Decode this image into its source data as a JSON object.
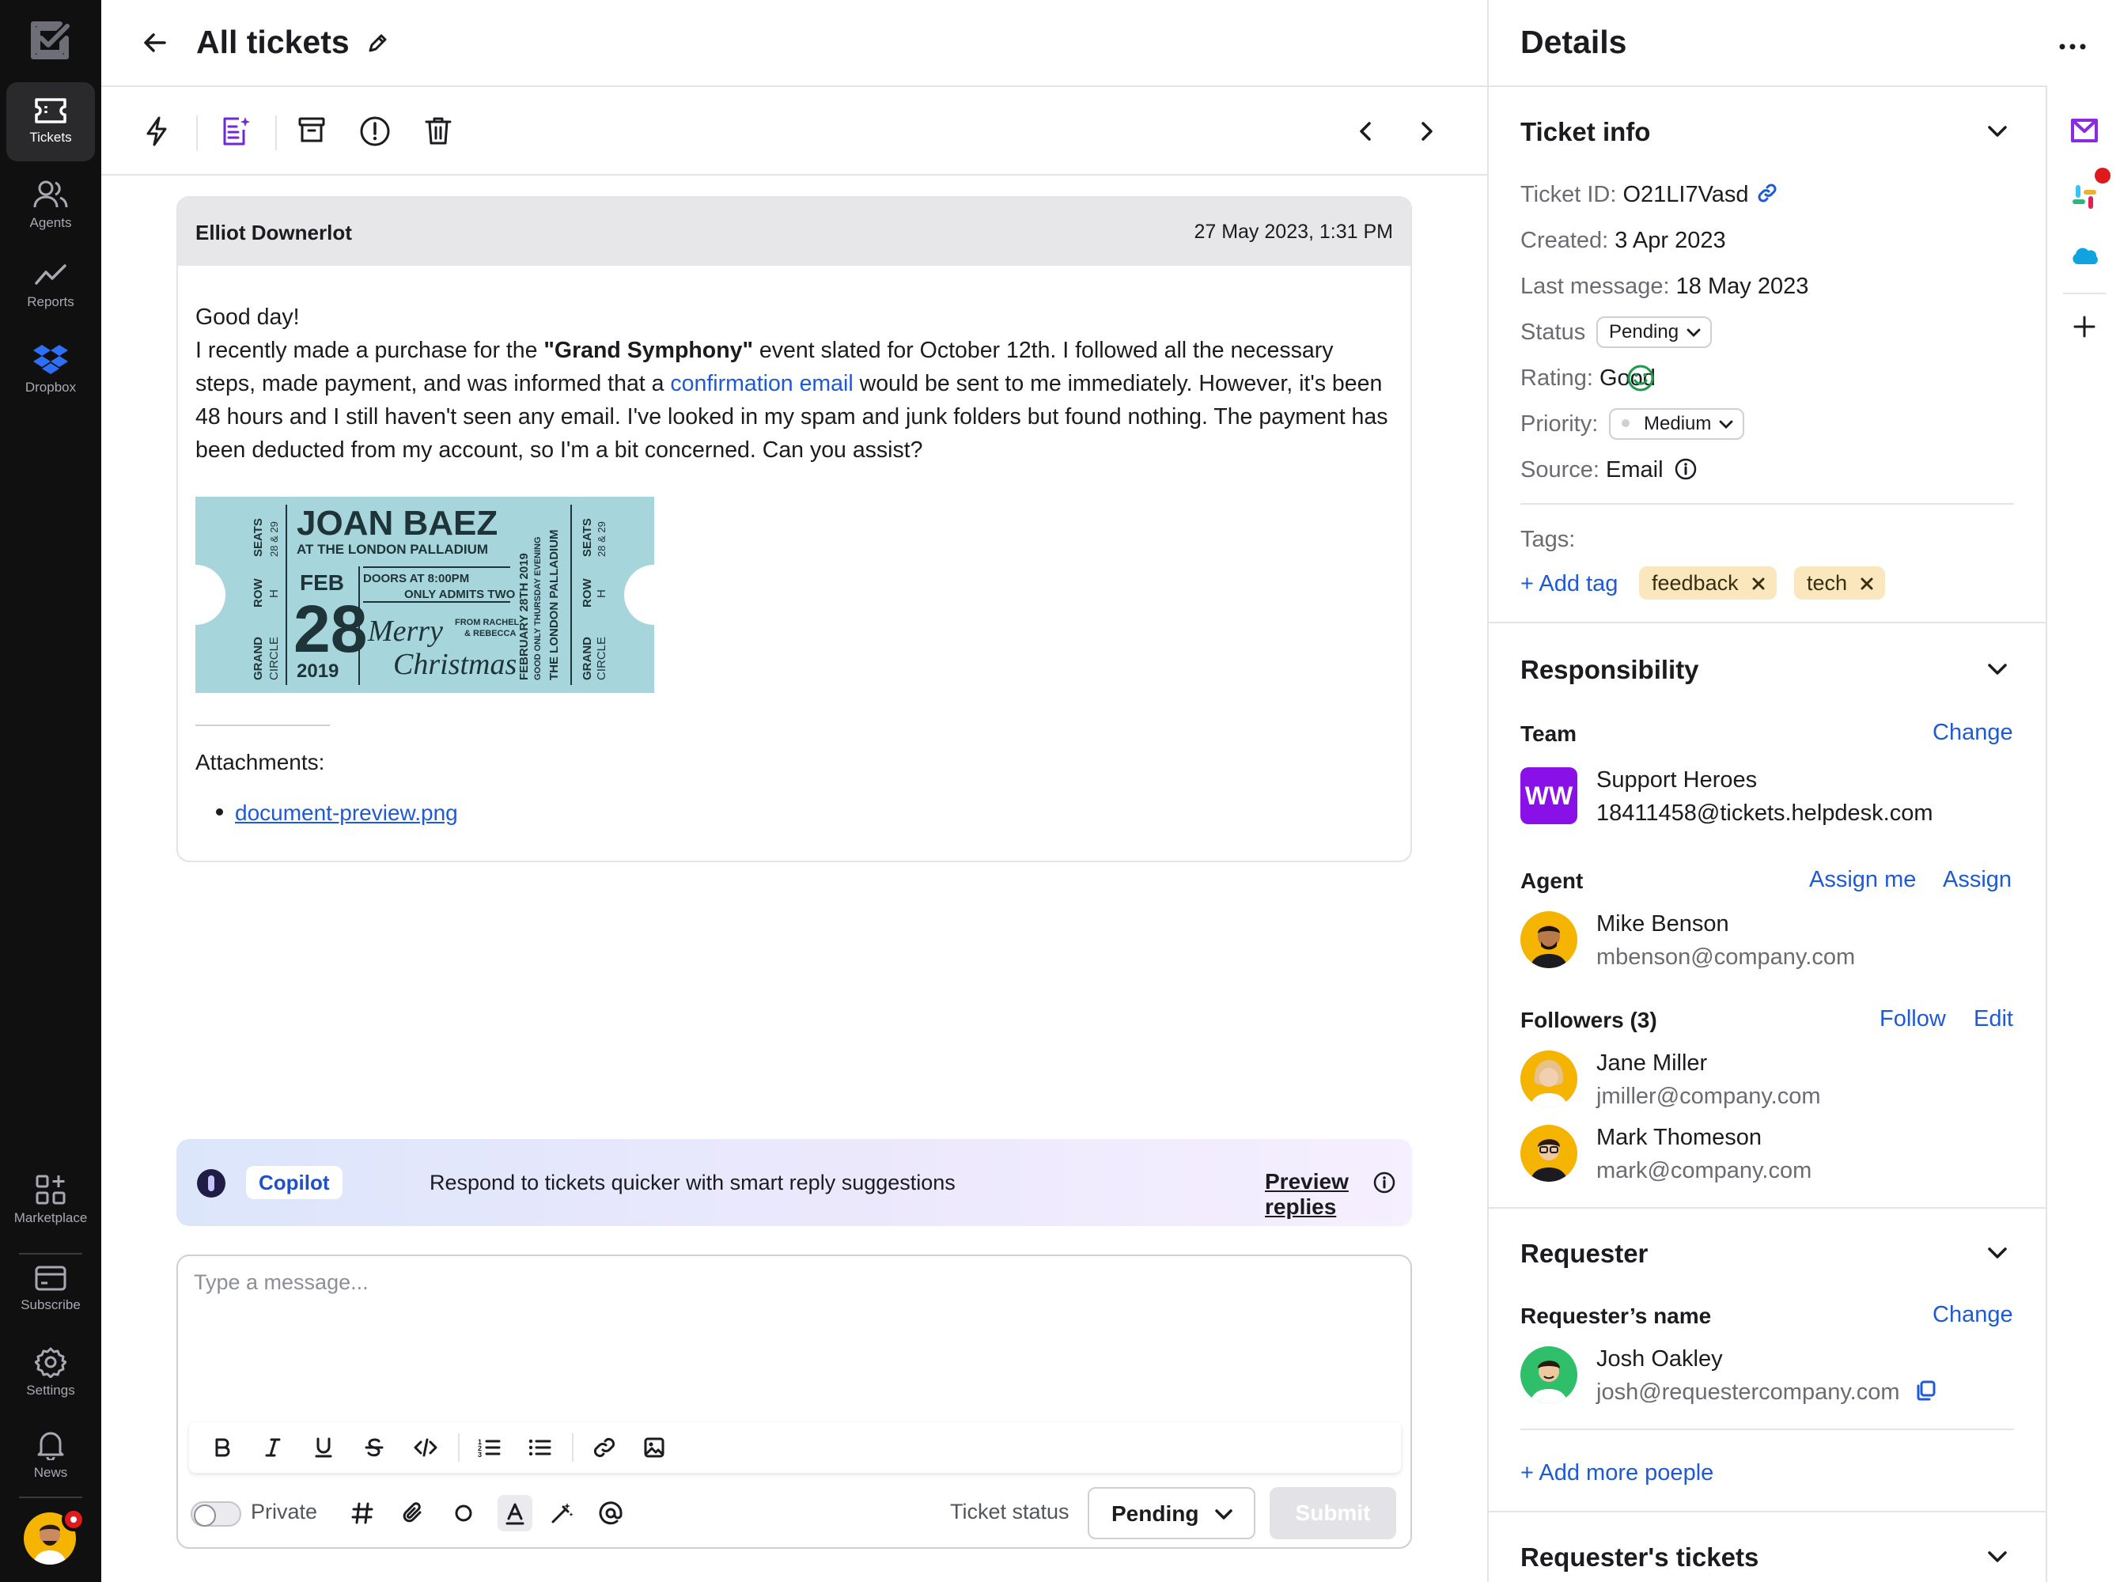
{
  "nav": {
    "items": [
      {
        "label": "Tickets",
        "icon": "ticket-icon",
        "active": true
      },
      {
        "label": "Agents",
        "icon": "agents-icon"
      },
      {
        "label": "Reports",
        "icon": "reports-icon"
      },
      {
        "label": "Dropbox",
        "icon": "dropbox-icon"
      }
    ],
    "bottom": [
      {
        "label": "Marketplace",
        "icon": "marketplace-icon"
      },
      {
        "label": "Subscribe",
        "icon": "card-icon"
      },
      {
        "label": "Settings",
        "icon": "gear-icon"
      },
      {
        "label": "News",
        "icon": "bell-icon"
      }
    ],
    "notification_color": "#e0191c"
  },
  "header": {
    "title": "All tickets"
  },
  "message": {
    "author": "Elliot Downerlot",
    "date": "27 May 2023, 1:31 PM",
    "greeting": "Good day!",
    "body_1": "I recently made a purchase for the ",
    "body_bold": "\"Grand Symphony\"",
    "body_2": " event slated for October 12th. I followed all the necessary steps, made payment, and was informed that a ",
    "body_link": "confirmation email",
    "body_3": " would be sent to me immediately. However, it's been 48 hours and I still haven't seen any email. I've looked in my spam and junk folders but found nothing. The payment has been deducted from my account, so I'm a bit concerned. Can you assist?",
    "ticket_image": {
      "headliner": "JOAN BAEZ",
      "venue": "AT THE LONDON PALLADIUM",
      "month": "FEB",
      "day": "28",
      "year": "2019",
      "doors": "DOORS AT 8:00PM",
      "admits": "ONLY ADMITS TWO",
      "from": "FROM RACHEL",
      "from2": "& REBECCA",
      "script": "Merry",
      "script2": "Christmas",
      "vertical": "THE LONDON PALLADIUM",
      "vertical2": "GOOD ONLY THURSDAY EVENING",
      "vertical3": "FEBRUARY 28TH 2019",
      "seats": "SEATS",
      "seats_val": "28 & 29",
      "row": "ROW",
      "row_val": "H",
      "grand": "GRAND",
      "circle": "CIRCLE"
    },
    "attachments_label": "Attachments:",
    "attachment": "document-preview.png"
  },
  "copilot": {
    "badge": "Copilot",
    "text": "Respond to tickets quicker with smart reply suggestions",
    "link": "Preview replies"
  },
  "composer": {
    "placeholder": "Type a message...",
    "private_label": "Private",
    "status_label": "Ticket status",
    "status_value": "Pending",
    "submit_label": "Submit"
  },
  "details": {
    "title": "Details",
    "ticket_info": {
      "title": "Ticket info",
      "id_label": "Ticket ID:",
      "id_value": "O21LI7Vasd",
      "created_label": "Created:",
      "created_value": "3 Apr 2023",
      "last_label": "Last message:",
      "last_value": "18 May 2023",
      "status_label": "Status",
      "status_value": "Pending",
      "rating_label": "Rating:",
      "rating_value": "Good",
      "priority_label": "Priority:",
      "priority_value": "Medium",
      "source_label": "Source:",
      "source_value": "Email",
      "tags_label": "Tags:",
      "add_tag": "+ Add tag",
      "tags": [
        "feedback",
        "tech"
      ]
    },
    "responsibility": {
      "title": "Responsibility",
      "team_label": "Team",
      "change": "Change",
      "team_initials": "WW",
      "team_name": "Support Heroes",
      "team_email": "18411458@tickets.helpdesk.com",
      "agent_label": "Agent",
      "assign_me": "Assign me",
      "assign": "Assign",
      "agent_name": "Mike Benson",
      "agent_email": "mbenson@company.com",
      "followers_label": "Followers (3)",
      "follow": "Follow",
      "edit": "Edit",
      "followers": [
        {
          "name": "Jane Miller",
          "email": "jmiller@company.com"
        },
        {
          "name": "Mark Thomeson",
          "email": "mark@company.com"
        }
      ]
    },
    "requester": {
      "title": "Requester",
      "name_label": "Requester’s name",
      "change": "Change",
      "name": "Josh Oakley",
      "email": "josh@requestercompany.com",
      "add_more": "+ Add more poeple"
    },
    "requester_tickets": {
      "title": "Requester's tickets"
    }
  },
  "rail": {
    "apps": [
      "mail-app-icon",
      "slack-icon",
      "salesforce-icon",
      "add-icon"
    ]
  }
}
